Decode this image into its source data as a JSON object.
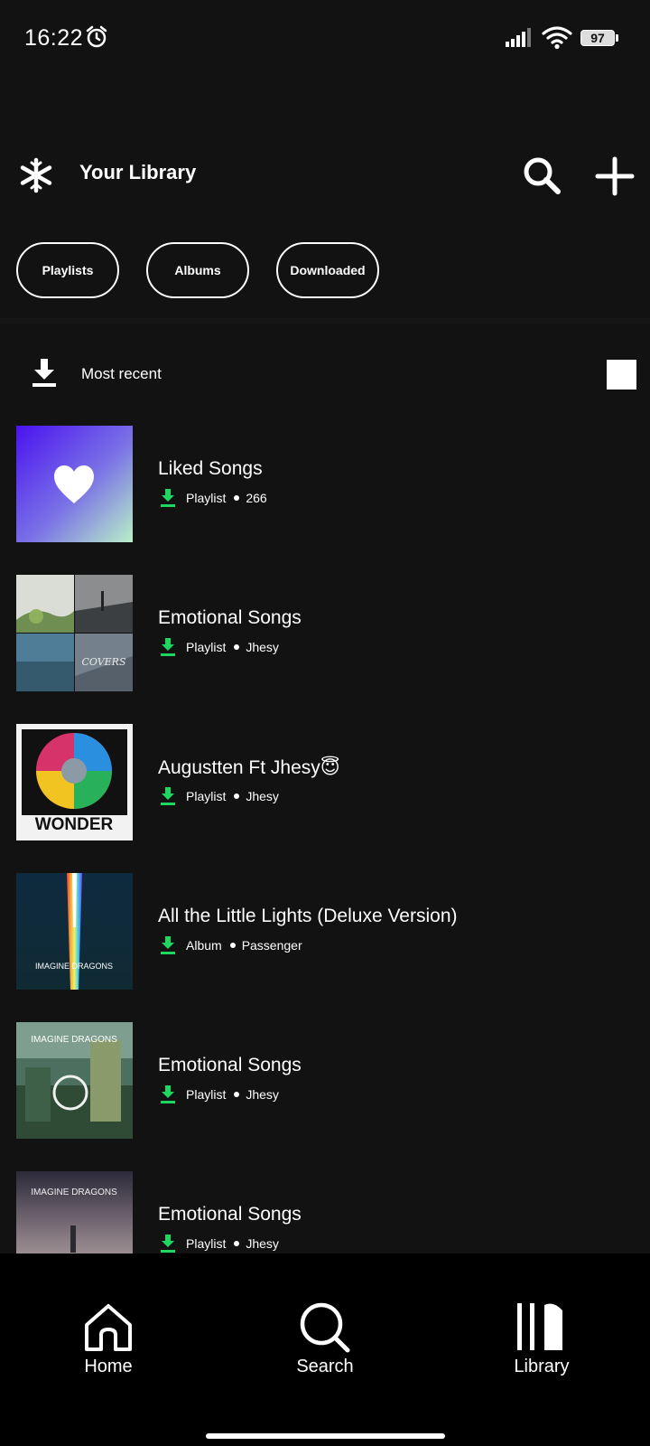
{
  "status_bar": {
    "time": "16:22",
    "battery": "97",
    "icons": [
      "alarm-icon",
      "signal-icon",
      "wifi-icon",
      "battery-icon"
    ]
  },
  "header": {
    "title": "Your Library",
    "icons": [
      "app-logo-icon",
      "search-icon",
      "plus-icon"
    ]
  },
  "filters": [
    "Playlists",
    "Albums",
    "Downloaded"
  ],
  "sort": {
    "label": "Most recent",
    "icons": [
      "download-icon",
      "grid-view-icon"
    ]
  },
  "library_items": [
    {
      "title": "Liked Songs",
      "type": "Playlist",
      "detail": "266",
      "cover": "liked-songs-cover"
    },
    {
      "title": "Emotional Songs",
      "type": "Playlist",
      "detail": "Jhesy",
      "cover": "collage-cover"
    },
    {
      "title": "Augustten Ft Jhesy😇",
      "type": "Playlist",
      "detail": "Jhesy",
      "cover": "wonder-cover",
      "cover_text": "WONDER"
    },
    {
      "title": "All the Little Lights (Deluxe Version)",
      "type": "Album",
      "detail": "Passenger",
      "cover": "evolve-cover",
      "cover_text": "IMAGINE DRAGONS"
    },
    {
      "title": "Emotional Songs",
      "type": "Playlist",
      "detail": "Jhesy",
      "cover": "origins-cover",
      "cover_text": "IMAGINE DRAGONS"
    },
    {
      "title": "Emotional Songs",
      "type": "Playlist",
      "detail": "Jhesy",
      "cover": "night-visions-cover",
      "cover_text": "IMAGINE DRAGONS"
    }
  ],
  "bottom_nav": [
    {
      "label": "Home",
      "icon": "home-icon"
    },
    {
      "label": "Search",
      "icon": "search-icon"
    },
    {
      "label": "Library",
      "icon": "library-icon"
    }
  ],
  "colors": {
    "background": "#121212",
    "download_green": "#1ed760",
    "nav_background": "#000000",
    "text": "#ffffff"
  }
}
